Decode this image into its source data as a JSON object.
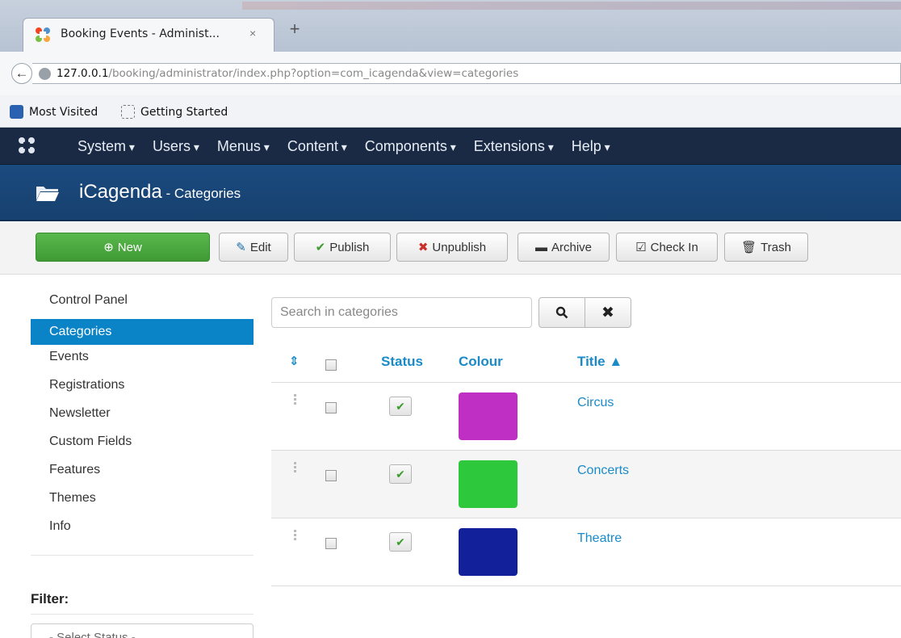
{
  "browser": {
    "tab_title": "Booking Events - Administ...",
    "tab_close": "×",
    "new_tab": "+",
    "back_icon": "←",
    "url_host": "127.0.0.1",
    "url_path": "/booking/administrator/index.php?option=com_icagenda&view=categories",
    "bookmarks": [
      "Most Visited",
      "Getting Started"
    ]
  },
  "navbar": {
    "menus": [
      "System",
      "Users",
      "Menus",
      "Content",
      "Components",
      "Extensions",
      "Help"
    ]
  },
  "header": {
    "title": "iCagenda",
    "subtitle": " - Categories"
  },
  "toolbar": {
    "new": "New",
    "edit": "Edit",
    "publish": "Publish",
    "unpublish": "Unpublish",
    "archive": "Archive",
    "check_in": "Check In",
    "trash": "Trash"
  },
  "sidebar": {
    "items": [
      "Control Panel",
      "Categories",
      "Events",
      "Registrations",
      "Newsletter",
      "Custom Fields",
      "Features",
      "Themes",
      "Info"
    ],
    "active": "Categories",
    "filter_label": "Filter:",
    "select_status": "- Select Status -"
  },
  "search": {
    "placeholder": "Search in categories",
    "search_icon": "search-icon",
    "clear_icon": "close-icon"
  },
  "table": {
    "headers": {
      "status": "Status",
      "colour": "Colour",
      "title": "Title ▲"
    },
    "rows": [
      {
        "title": "Circus",
        "colour": "#c02fc4",
        "published": true
      },
      {
        "title": "Concerts",
        "colour": "#2ec83c",
        "published": true
      },
      {
        "title": "Theatre",
        "colour": "#12219a",
        "published": true
      }
    ]
  }
}
